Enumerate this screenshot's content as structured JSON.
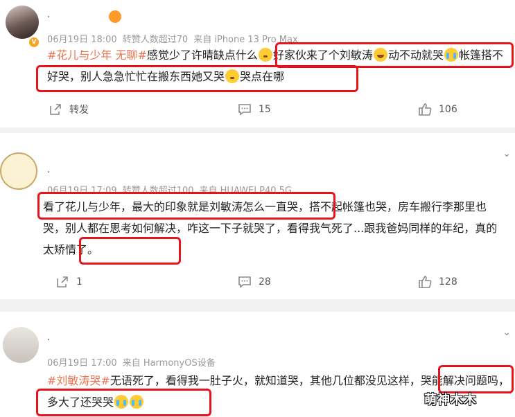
{
  "posts": [
    {
      "username": ".",
      "meta": [
        "06月19日 18:00",
        "转赞人数超过70",
        "来自 iPhone 13 Pro Max"
      ],
      "segments": [
        {
          "t": "#花儿与少年 无聊#",
          "topic": true
        },
        {
          "t": "感觉少了许晴缺点什么"
        },
        {
          "emo": "think"
        },
        {
          "t": "好家伙来了个刘敏涛"
        },
        {
          "emo": "laugh"
        },
        {
          "t": "动不动就哭"
        },
        {
          "emo": "cry"
        },
        {
          "t": "帐篷搭不好哭，别人急急忙忙在搬东西她又哭"
        },
        {
          "emo": "think"
        },
        {
          "t": "哭点在哪"
        }
      ],
      "actions": {
        "repost": "转发",
        "comments": "15",
        "likes": "106"
      }
    },
    {
      "username": ".",
      "meta": [
        "06月19日 17:09",
        "转赞人数超过100",
        "来自 HUAWEI P40 5G"
      ],
      "segments": [
        {
          "t": "看了花儿与少年，最大的印象就是刘敏涛怎么一直哭，搭不起帐篷也哭，房车搬行李那里也哭，别人都在思考如何解决，咋这一下子就哭了，看得我气死了...跟我爸妈同样的年纪，真的太矫情了。"
        }
      ],
      "actions": {
        "repost": "1",
        "comments": "28",
        "likes": "128"
      }
    },
    {
      "username": ".",
      "meta": [
        "06月19日 17:00",
        "来自 HarmonyOS设备"
      ],
      "segments": [
        {
          "t": "#刘敏涛哭#",
          "topic": true
        },
        {
          "t": "无语死了，看得我一肚子火，就知道哭，其他几位都没见这样，哭能解决问题吗，多大了还哭哭"
        },
        {
          "emo": "cry"
        },
        {
          "emo": "cry"
        }
      ]
    }
  ],
  "watermark": "萌神木木"
}
